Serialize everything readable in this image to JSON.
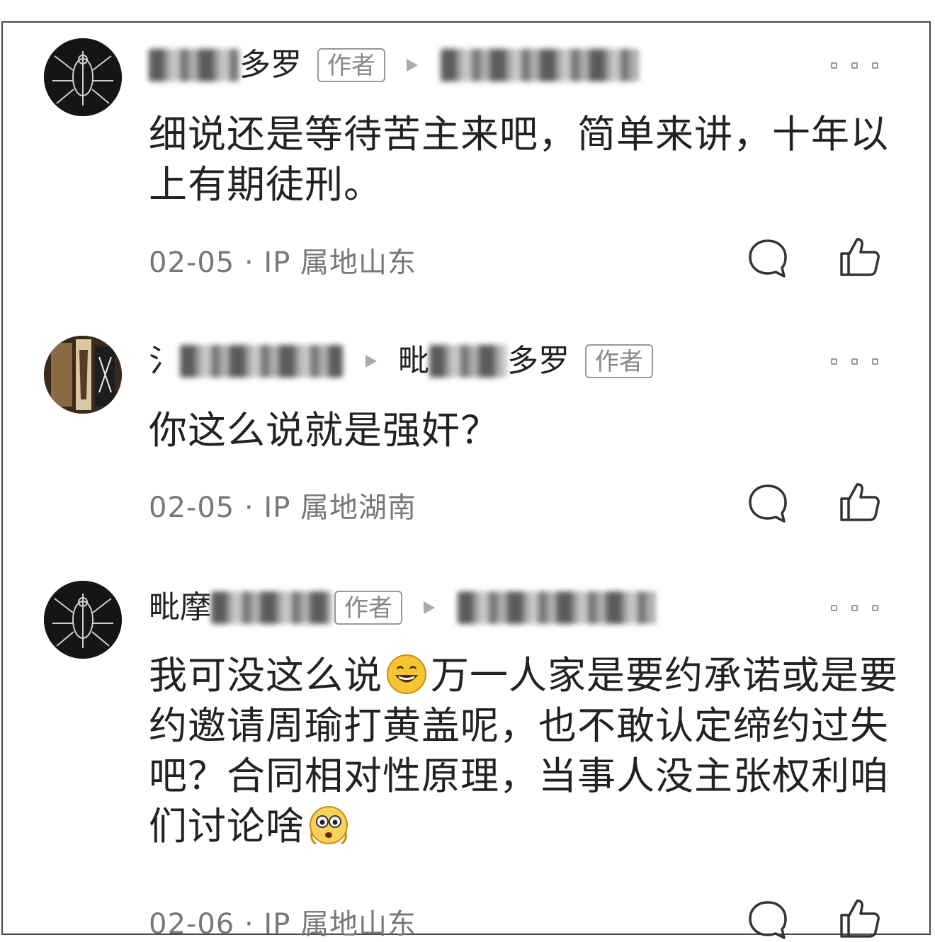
{
  "comments": [
    {
      "user_visible": "多罗",
      "author_badge": "作者",
      "content": "细说还是等待苦主来吧，简单来讲，十年以上有期徒刑。",
      "date": "02-05",
      "location": "IP 属地山东"
    },
    {
      "user_visible": "氵",
      "target_visible_start": "毗",
      "target_visible_end": "多罗",
      "author_badge": "作者",
      "content": "你这么说就是强奸？",
      "date": "02-05",
      "location": "IP 属地湖南"
    },
    {
      "user_visible": "毗摩",
      "author_badge": "作者",
      "content_part1": "我可没这么说",
      "content_part2": "万一人家是要约承诺或是要约邀请周瑜打黄盖呢，也不敢认定缔约过失吧？合同相对性原理，当事人没主张权利咱们讨论啥",
      "date": "02-06",
      "location": "IP 属地山东"
    }
  ],
  "icons": [
    "reply-icon",
    "like-icon",
    "more-icon",
    "grin-emoji",
    "shocked-emoji"
  ]
}
